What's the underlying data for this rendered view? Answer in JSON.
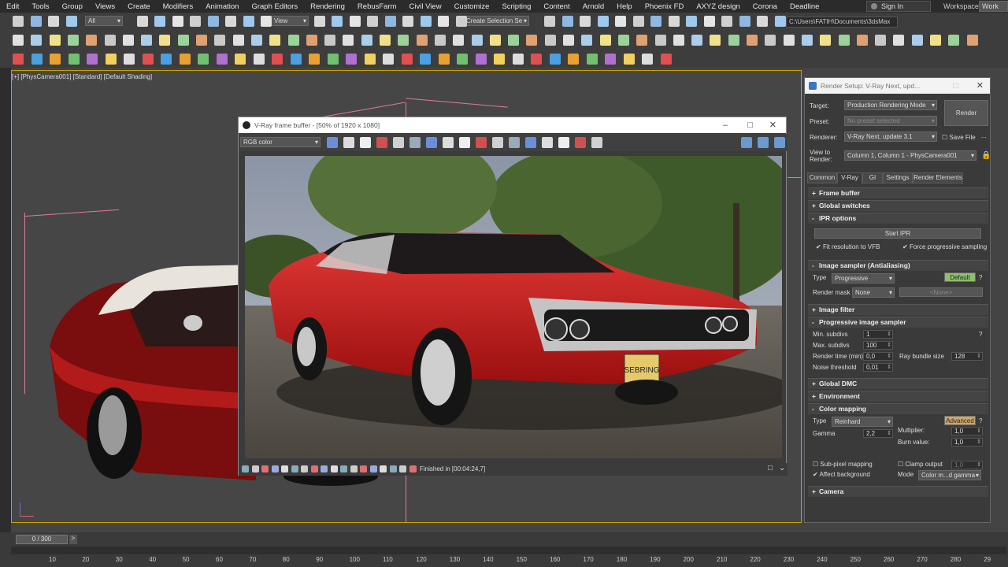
{
  "menu": [
    "Edit",
    "Tools",
    "Group",
    "Views",
    "Create",
    "Modifiers",
    "Animation",
    "Graph Editors",
    "Rendering",
    "RebusFarm",
    "Civil View",
    "Customize",
    "Scripting",
    "Content",
    "Arnold",
    "Help",
    "Phoenix FD",
    "AXYZ design",
    "Corona",
    "Deadline"
  ],
  "signin": "Sign In",
  "workspaces_label": "Workspaces:",
  "workspaces_value": "Work",
  "toolbar": {
    "filter": "All",
    "view": "View",
    "selection_set": "Create Selection Se",
    "project_path": "C:\\Users\\FATIH\\Documents\\3dsMax"
  },
  "viewport_label": "[+] [PhysCamera001] [Standard] [Default Shading]",
  "vfb": {
    "title": "V-Ray frame buffer - [50% of 1920 x 1080]",
    "channel": "RGB color",
    "status": "Finished in [00:04:24,7]",
    "plate_top": "SEBRING"
  },
  "render_setup": {
    "title": "Render Setup: V-Ray Next, upd...",
    "target_label": "Target:",
    "target": "Production Rendering Mode",
    "preset_label": "Preset:",
    "preset": "No preset selected",
    "renderer_label": "Renderer:",
    "renderer": "V-Ray Next, update 3.1",
    "save_file": "Save File",
    "view_label": "View to Render:",
    "view": "Column 1, Column 1 - PhysCamera001",
    "render_button": "Render",
    "tabs": [
      "Common",
      "V-Ray",
      "GI",
      "Settings",
      "Render Elements"
    ],
    "rollouts": {
      "frame_buffer": "Frame buffer",
      "global_switches": "Global switches",
      "ipr_options": "IPR options",
      "image_sampler": "Image sampler (Antialiasing)",
      "image_filter": "Image filter",
      "progressive": "Progressive image sampler",
      "global_dmc": "Global DMC",
      "environment": "Environment",
      "color_mapping": "Color mapping",
      "camera": "Camera"
    },
    "start_ipr": "Start IPR",
    "fit_vfb": "Fit resolution to VFB",
    "force_progressive": "Force progressive sampling",
    "type_label": "Type",
    "sampler_type": "Progressive",
    "default_btn": "Default",
    "render_mask_label": "Render mask",
    "render_mask": "None",
    "render_mask_none": "<None>",
    "min_subdivs_label": "Min. subdivs",
    "min_subdivs": "1",
    "max_subdivs_label": "Max. subdivs",
    "max_subdivs": "100",
    "render_time_label": "Render time (min)",
    "render_time": "0,0",
    "ray_bundle_label": "Ray bundle size",
    "ray_bundle": "128",
    "noise_label": "Noise threshold",
    "noise": "0,01",
    "cm_type": "Reinhard",
    "advanced_btn": "Advanced",
    "gamma_label": "Gamma",
    "gamma": "2,2",
    "multiplier_label": "Multiplier:",
    "multiplier": "1,0",
    "burn_label": "Burn value:",
    "burn": "1,0",
    "subpixel": "Sub-pixel mapping",
    "clamp": "Clamp output",
    "clamp_value": "1,0",
    "affect_bg": "Affect background",
    "mode_label": "Mode",
    "mode": "Color m...d gamma"
  },
  "timeline": {
    "frame": "0 / 300",
    "ticks": [
      "10",
      "20",
      "30",
      "40",
      "50",
      "60",
      "70",
      "80",
      "90",
      "100",
      "110",
      "120",
      "130",
      "140",
      "150",
      "160",
      "170",
      "180",
      "190",
      "200",
      "210",
      "220",
      "230",
      "240",
      "250",
      "260",
      "270",
      "280",
      "29"
    ]
  }
}
